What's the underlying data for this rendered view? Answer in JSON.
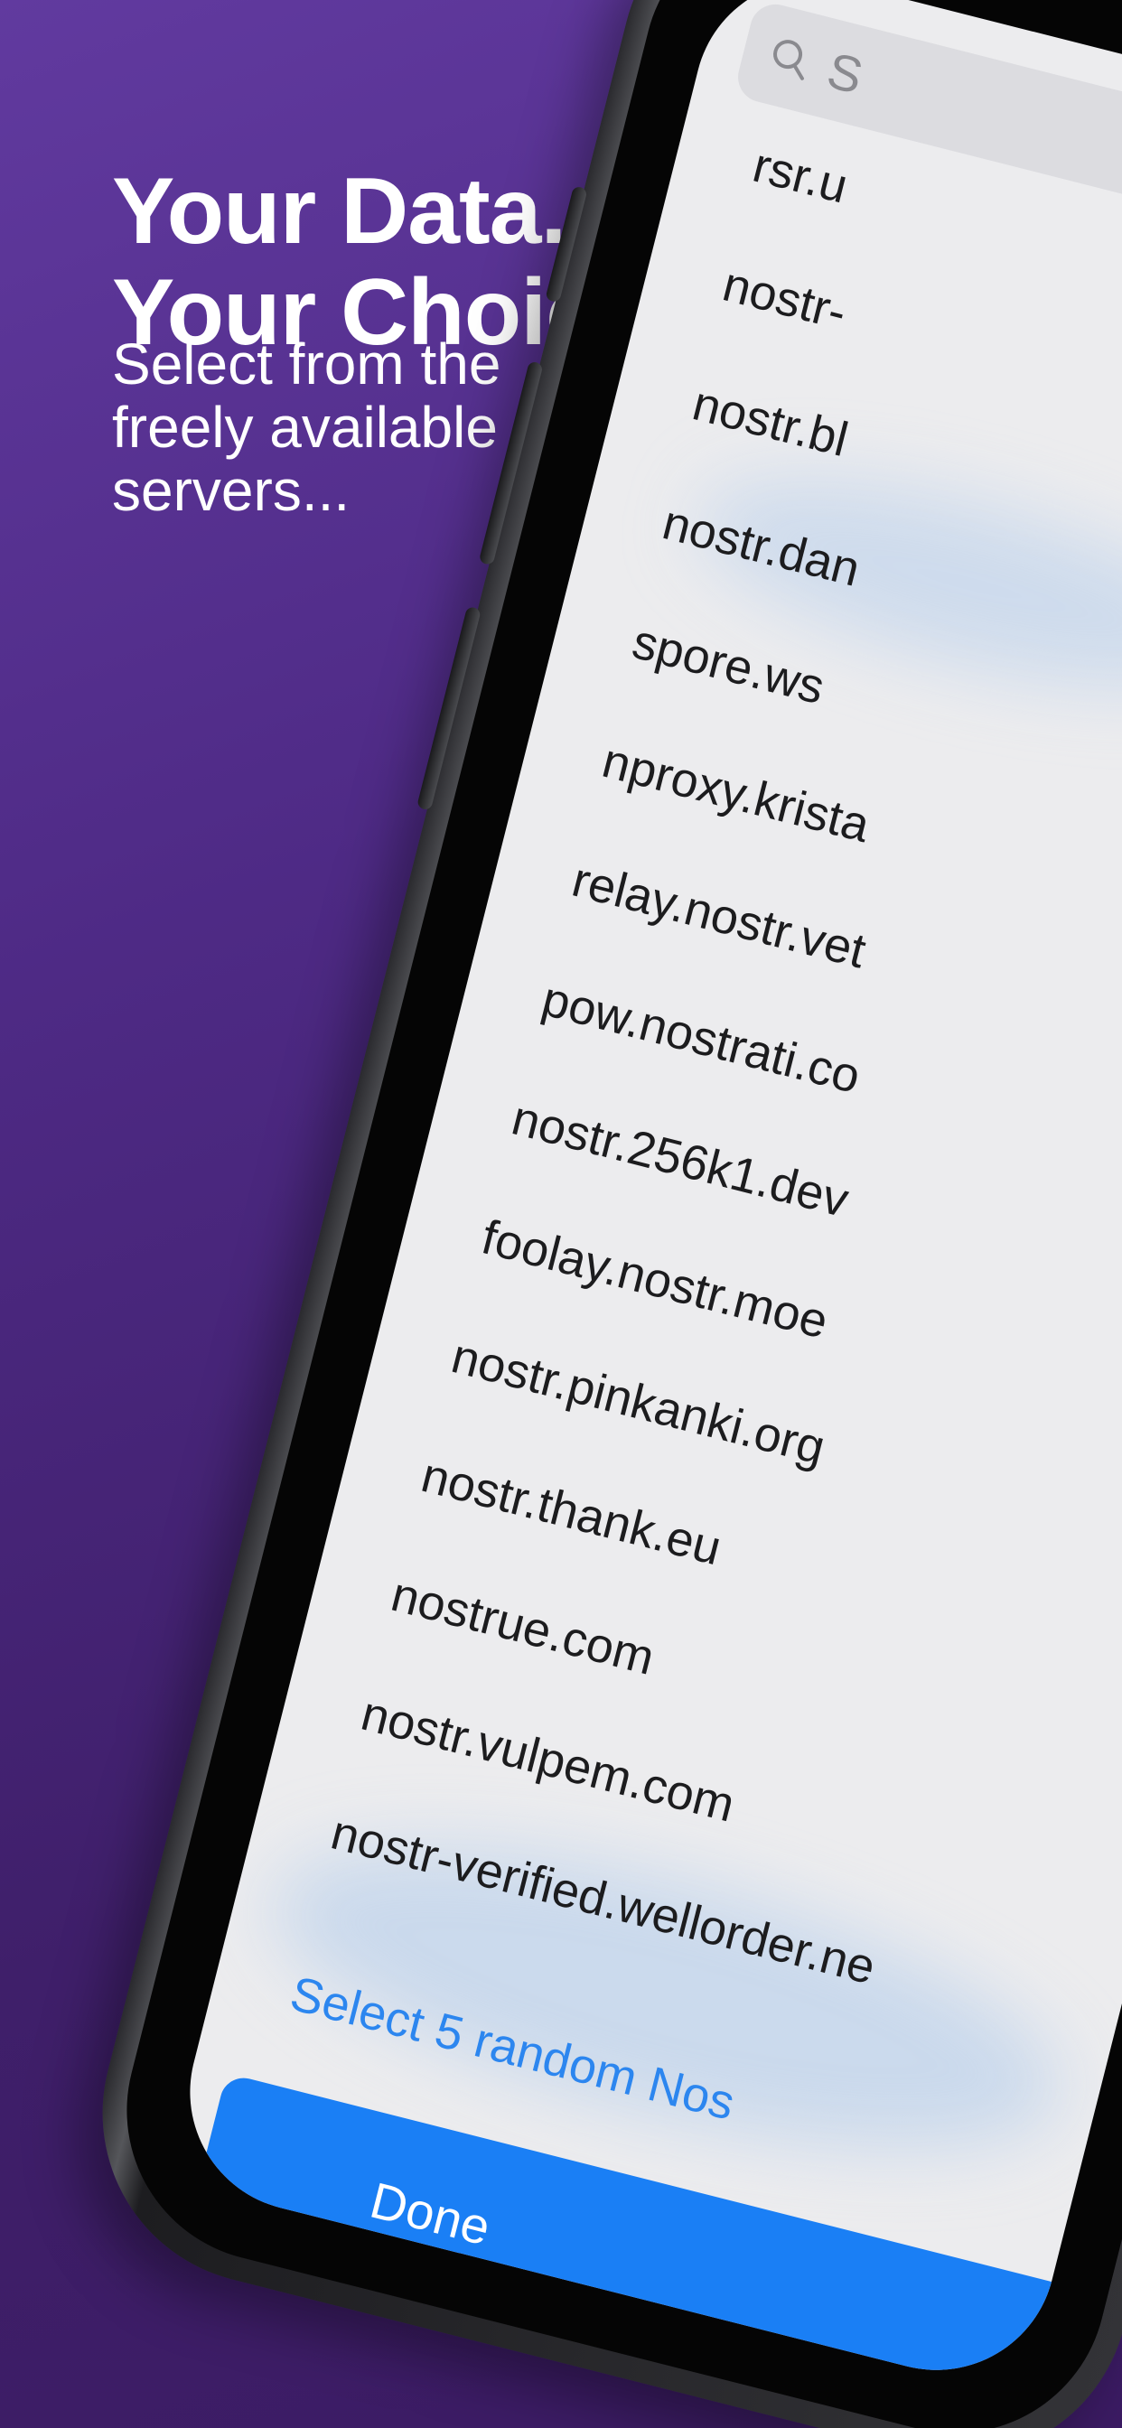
{
  "headline": {
    "line1": "Your Data.",
    "line2": "Your Choice."
  },
  "subline": "Select from the freely available servers...",
  "search": {
    "icon": "search-icon",
    "placeholder": "S"
  },
  "relays": [
    "rsr.u",
    "nostr-",
    "nostr.bl",
    "nostr.dan",
    "spore.ws",
    "nproxy.krista",
    "relay.nostr.vet",
    "pow.nostrati.co",
    "nostr.256k1.dev",
    "foolay.nostr.moe",
    "nostr.pinkanki.org",
    "nostr.thank.eu",
    "nostrue.com",
    "nostr.vulpem.com",
    "nostr-verified.wellorder.ne"
  ],
  "random_link": "Select 5 random Nos",
  "done_button": "Done",
  "colors": {
    "background_top": "#613a9f",
    "background_bottom": "#3b1b63",
    "link": "#2c86ef",
    "button": "#1a7ff5"
  }
}
